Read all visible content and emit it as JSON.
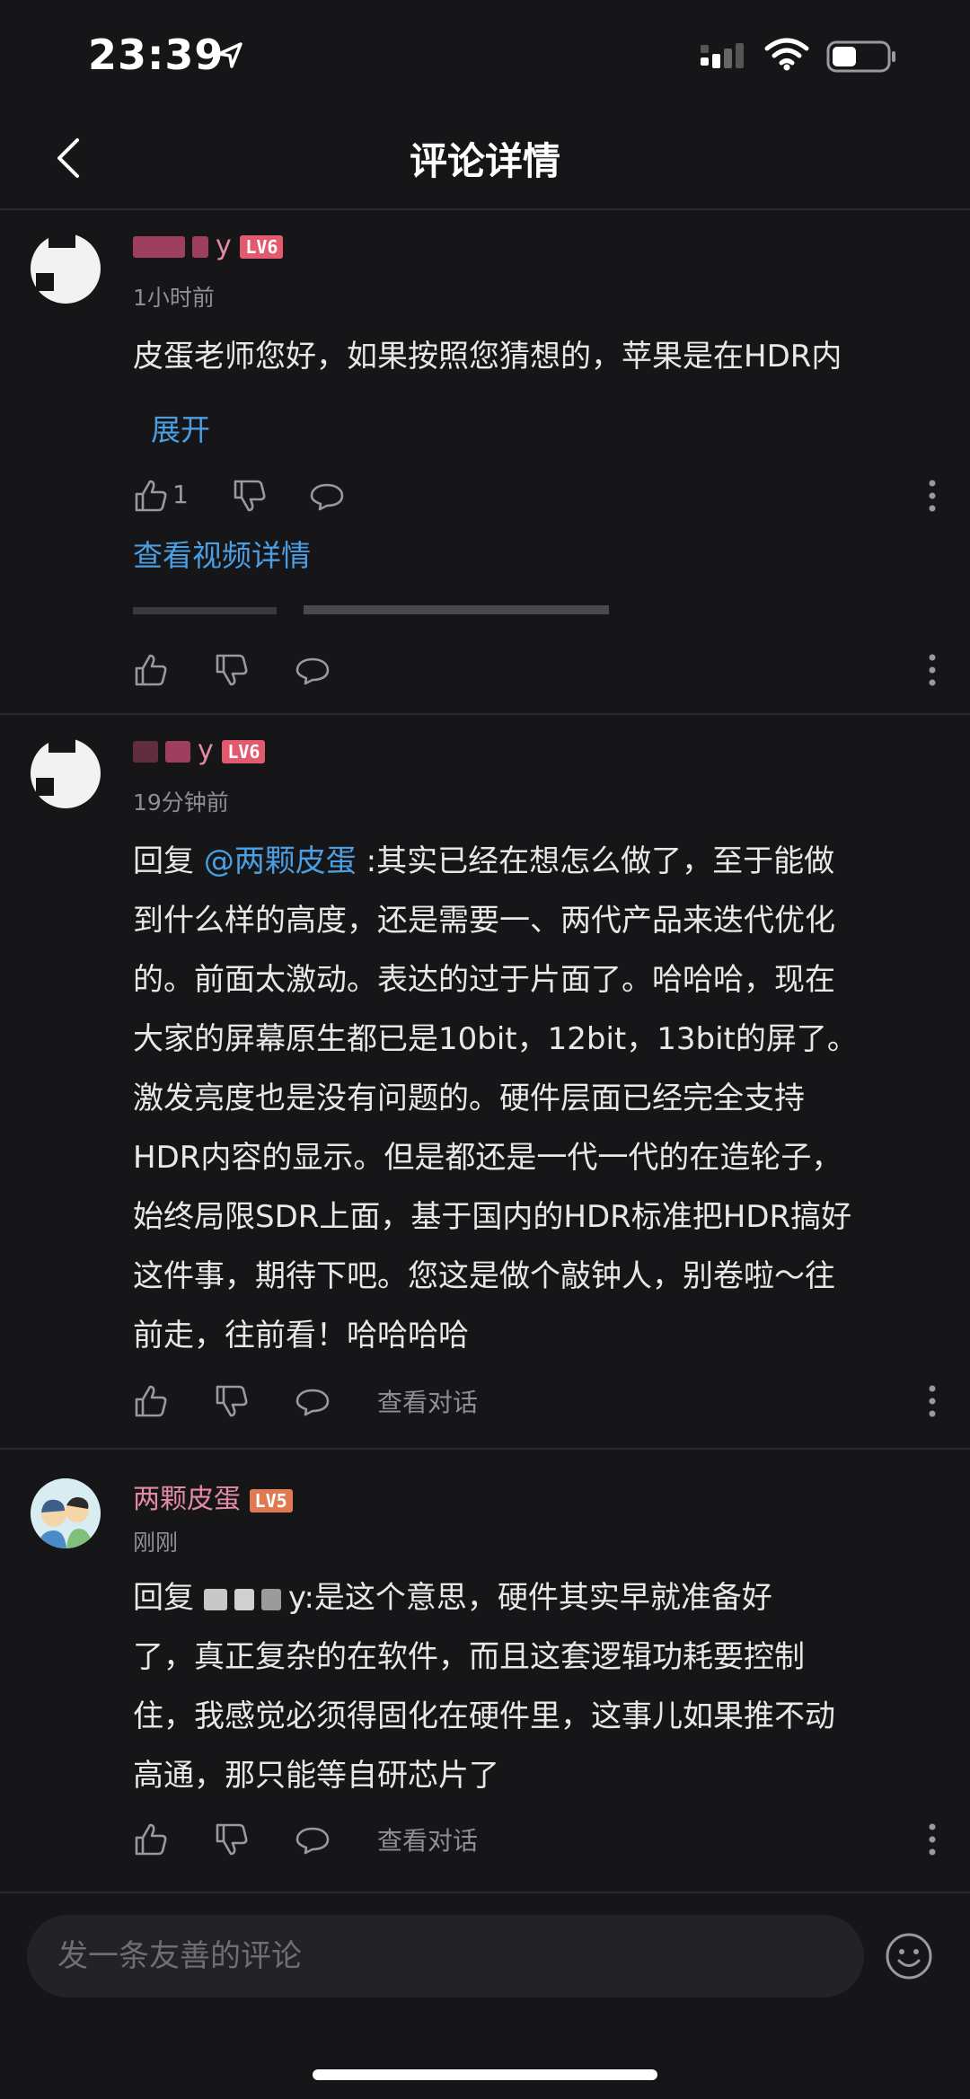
{
  "status_bar": {
    "time": "23:39"
  },
  "nav": {
    "title": "评论详情"
  },
  "comments": [
    {
      "username_suffix": "y",
      "level": "LV6",
      "time": "1小时前",
      "text": "皮蛋老师您好，如果按照您猜想的，苹果是在HDR内",
      "expand": "展开",
      "likes": "1",
      "view_video": "查看视频详情"
    },
    {
      "username_suffix": "y",
      "level": "LV6",
      "time": "19分钟前",
      "reply_prefix": "回复 ",
      "mention": "@两颗皮蛋",
      "lines": [
        " :其实已经在想怎么做了，至于能做",
        "到什么样的高度，还是需要一、两代产品来迭代优化",
        "的。前面太激动。表达的过于片面了。哈哈哈，现在",
        "大家的屏幕原生都已是10bit，12bit，13bit的屏了。",
        "激发亮度也是没有问题的。硬件层面已经完全支持",
        "HDR内容的显示。但是都还是一代一代的在造轮子，",
        "始终局限SDR上面，基于国内的HDR标准把HDR搞好",
        "这件事，期待下吧。您这是做个敲钟人，别卷啦～往",
        "前走，往前看！哈哈哈哈"
      ],
      "view_conversation": "查看对话"
    },
    {
      "username": "两颗皮蛋",
      "level": "LV5",
      "time": "刚刚",
      "reply_prefix": "回复 ",
      "mention_suffix": "y",
      "lines": [
        ":是这个意思，硬件其实早就准备好",
        "了，真正复杂的在软件，而且这套逻辑功耗要控制",
        "住，我感觉必须得固化在硬件里，这事儿如果推不动",
        "高通，那只能等自研芯片了"
      ],
      "view_conversation": "查看对话"
    }
  ],
  "input": {
    "placeholder": "发一条友善的评论"
  },
  "colors": {
    "background": "#161618",
    "link": "#4a9ee2",
    "username": "#e38aa6",
    "level_badge": "#e25a6e"
  },
  "icons": [
    "back-icon",
    "location-arrow-icon",
    "signal-icon",
    "wifi-icon",
    "battery-icon",
    "like-icon",
    "dislike-icon",
    "comment-icon",
    "more-icon",
    "emoji-icon"
  ]
}
